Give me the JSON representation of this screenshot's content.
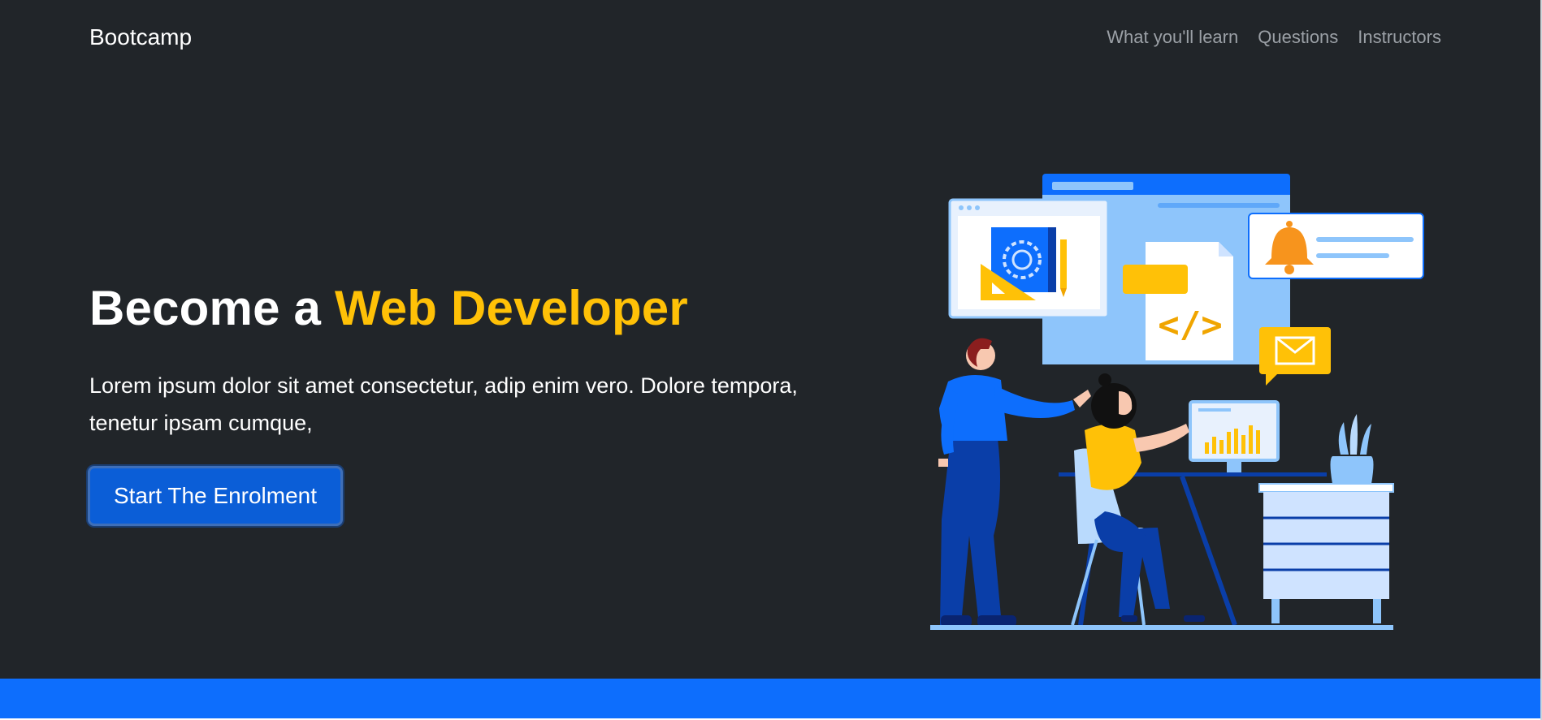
{
  "navbar": {
    "brand": "Bootcamp",
    "links": [
      "What you'll learn",
      "Questions",
      "Instructors"
    ]
  },
  "hero": {
    "title_prefix": "Become a ",
    "title_highlight": "Web Developer",
    "description": "Lorem ipsum dolor sit amet consectetur, adip enim vero. Dolore tempora, tenetur ipsam cumque,",
    "cta_label": "Start The Enrolment",
    "illustration": {
      "code_symbol": "</>",
      "icons": [
        "gear-icon",
        "bell-icon",
        "envelope-icon",
        "bar-chart-icon"
      ]
    }
  },
  "colors": {
    "background": "#212529",
    "accent": "#ffc107",
    "primary": "#0d6efd",
    "nav_link": "#9ba0a6"
  }
}
